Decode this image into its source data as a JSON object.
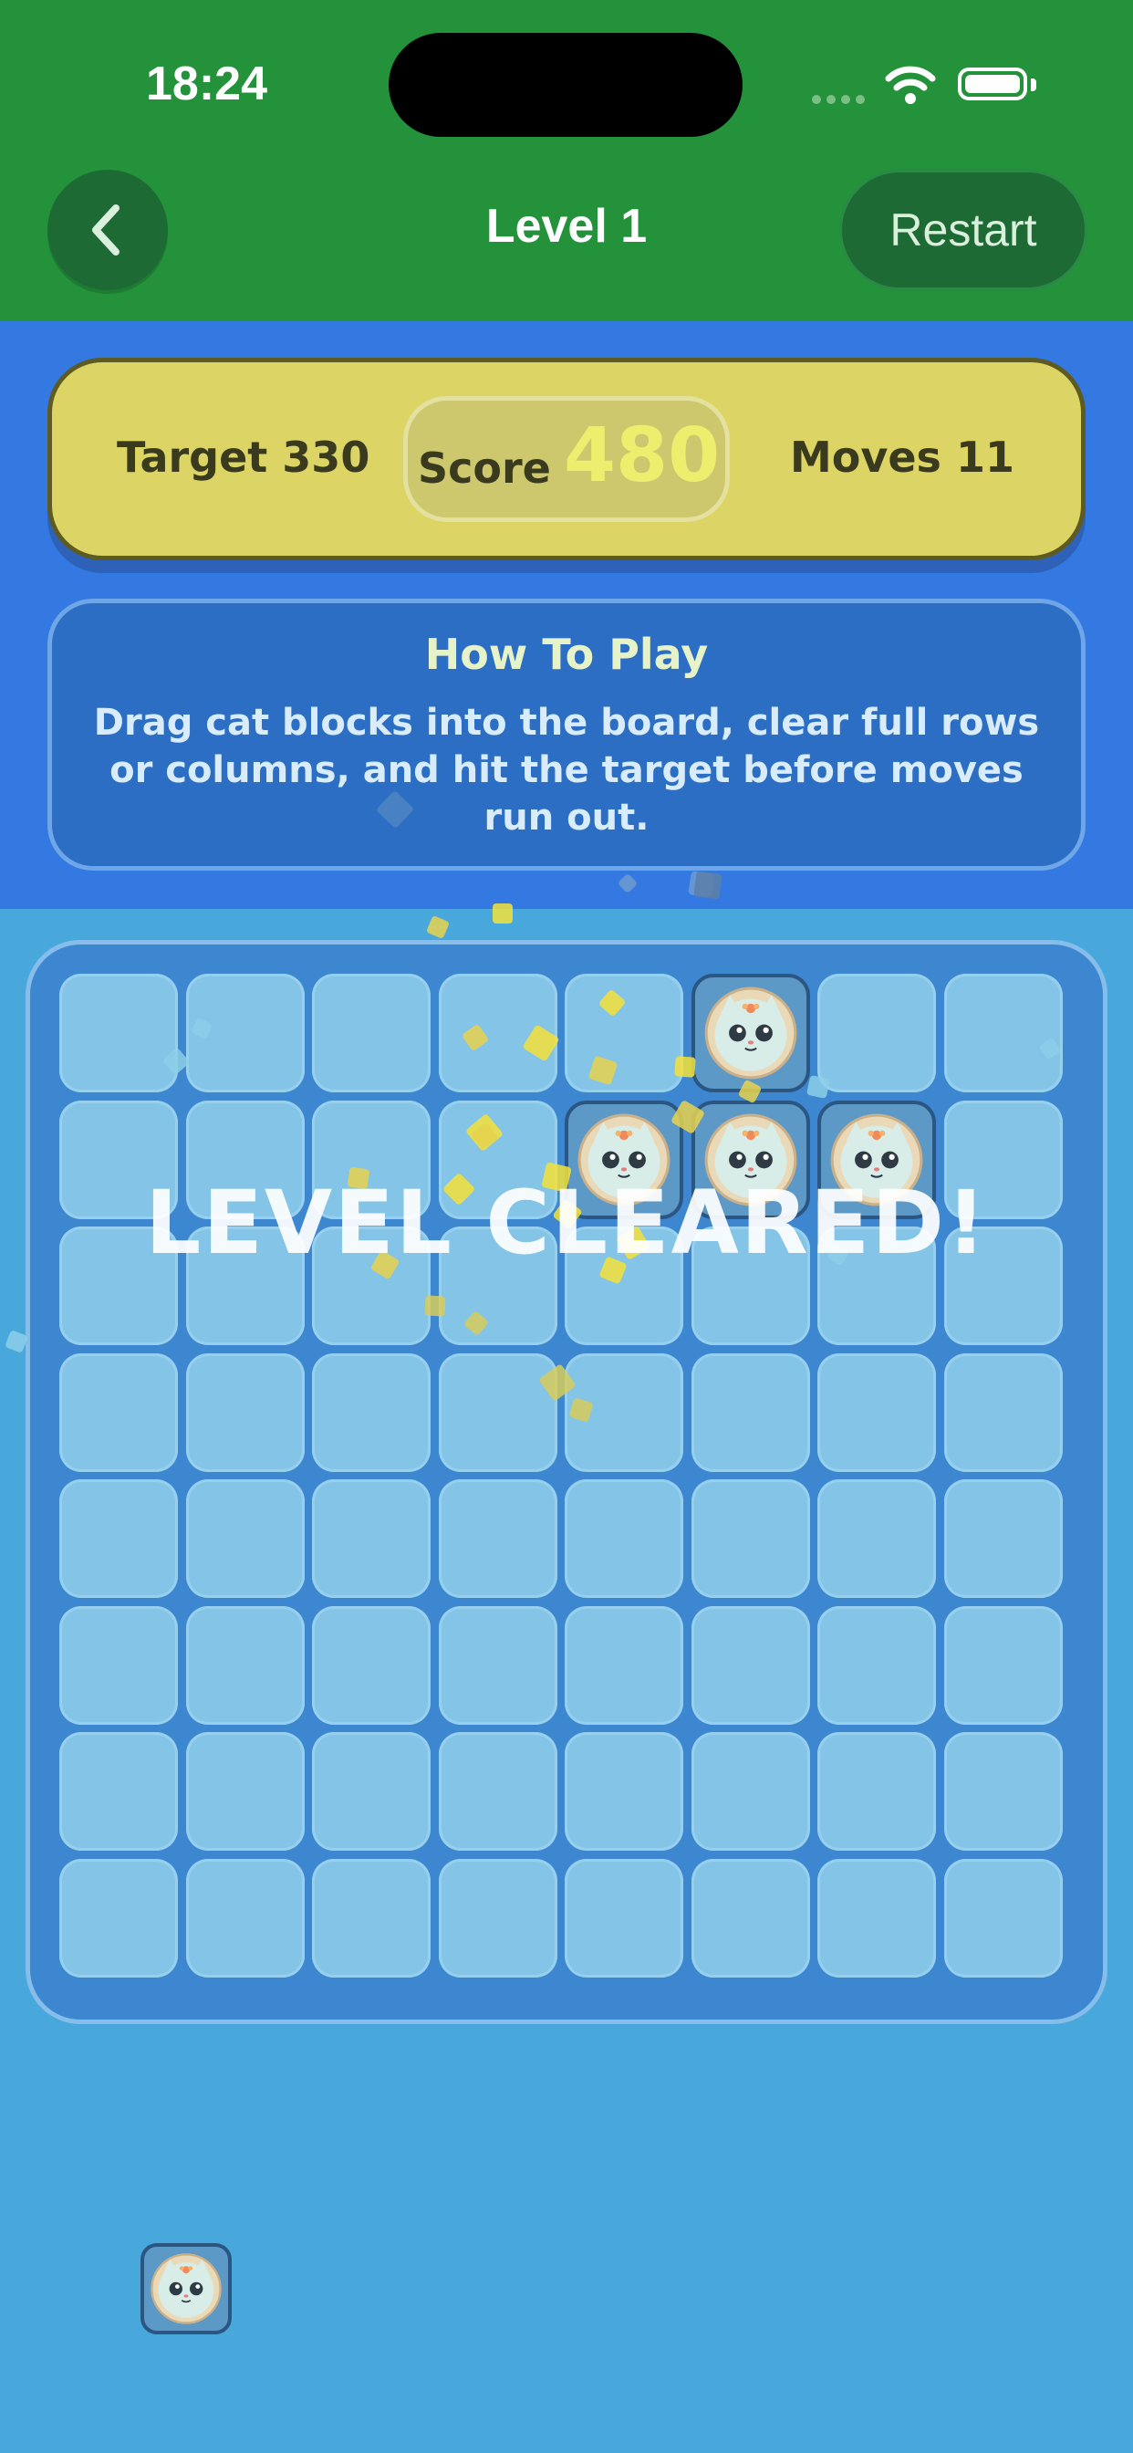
{
  "status_bar": {
    "time": "18:24"
  },
  "nav": {
    "title": "Level 1",
    "restart_label": "Restart"
  },
  "score_bar": {
    "target_label": "Target 330",
    "score_label": "Score",
    "score_value": "480",
    "moves_label": "Moves 11"
  },
  "how_to_play": {
    "title": "How To Play",
    "body": "Drag cat blocks into the board, clear full rows or columns, and hit the target before moves run out."
  },
  "board": {
    "rows": 8,
    "cols": 8,
    "cat_cells": [
      [
        0,
        5
      ],
      [
        1,
        4
      ],
      [
        1,
        5
      ],
      [
        1,
        6
      ]
    ]
  },
  "overlay": {
    "message": "LEVEL CLEARED!"
  },
  "tray": {
    "pieces": [
      {
        "name": "single-cat-block"
      }
    ]
  },
  "colors": {
    "header": "#23923a",
    "panel": "#3479e2",
    "score_bar": "#dcd565",
    "board": "#3d87d1",
    "cell": "#84c4e6",
    "background": "#48a8dc"
  }
}
